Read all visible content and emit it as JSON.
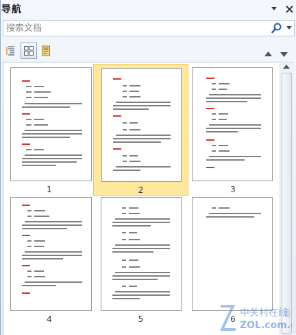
{
  "panel": {
    "title": "导航"
  },
  "search": {
    "placeholder": "搜索文档"
  },
  "view_tabs": [
    {
      "name": "headings-view"
    },
    {
      "name": "pages-view",
      "active": true
    },
    {
      "name": "results-view"
    }
  ],
  "pages": [
    {
      "number": "1"
    },
    {
      "number": "2",
      "selected": true
    },
    {
      "number": "3"
    },
    {
      "number": "4"
    },
    {
      "number": "5"
    },
    {
      "number": "6"
    }
  ],
  "watermark": {
    "cn": "中关村在线",
    "en": "ZOL.com.cn"
  },
  "colors": {
    "selection_fill": "#fde89e",
    "heading_red": "#d0362a",
    "accent_blue": "#2a5ca8"
  }
}
